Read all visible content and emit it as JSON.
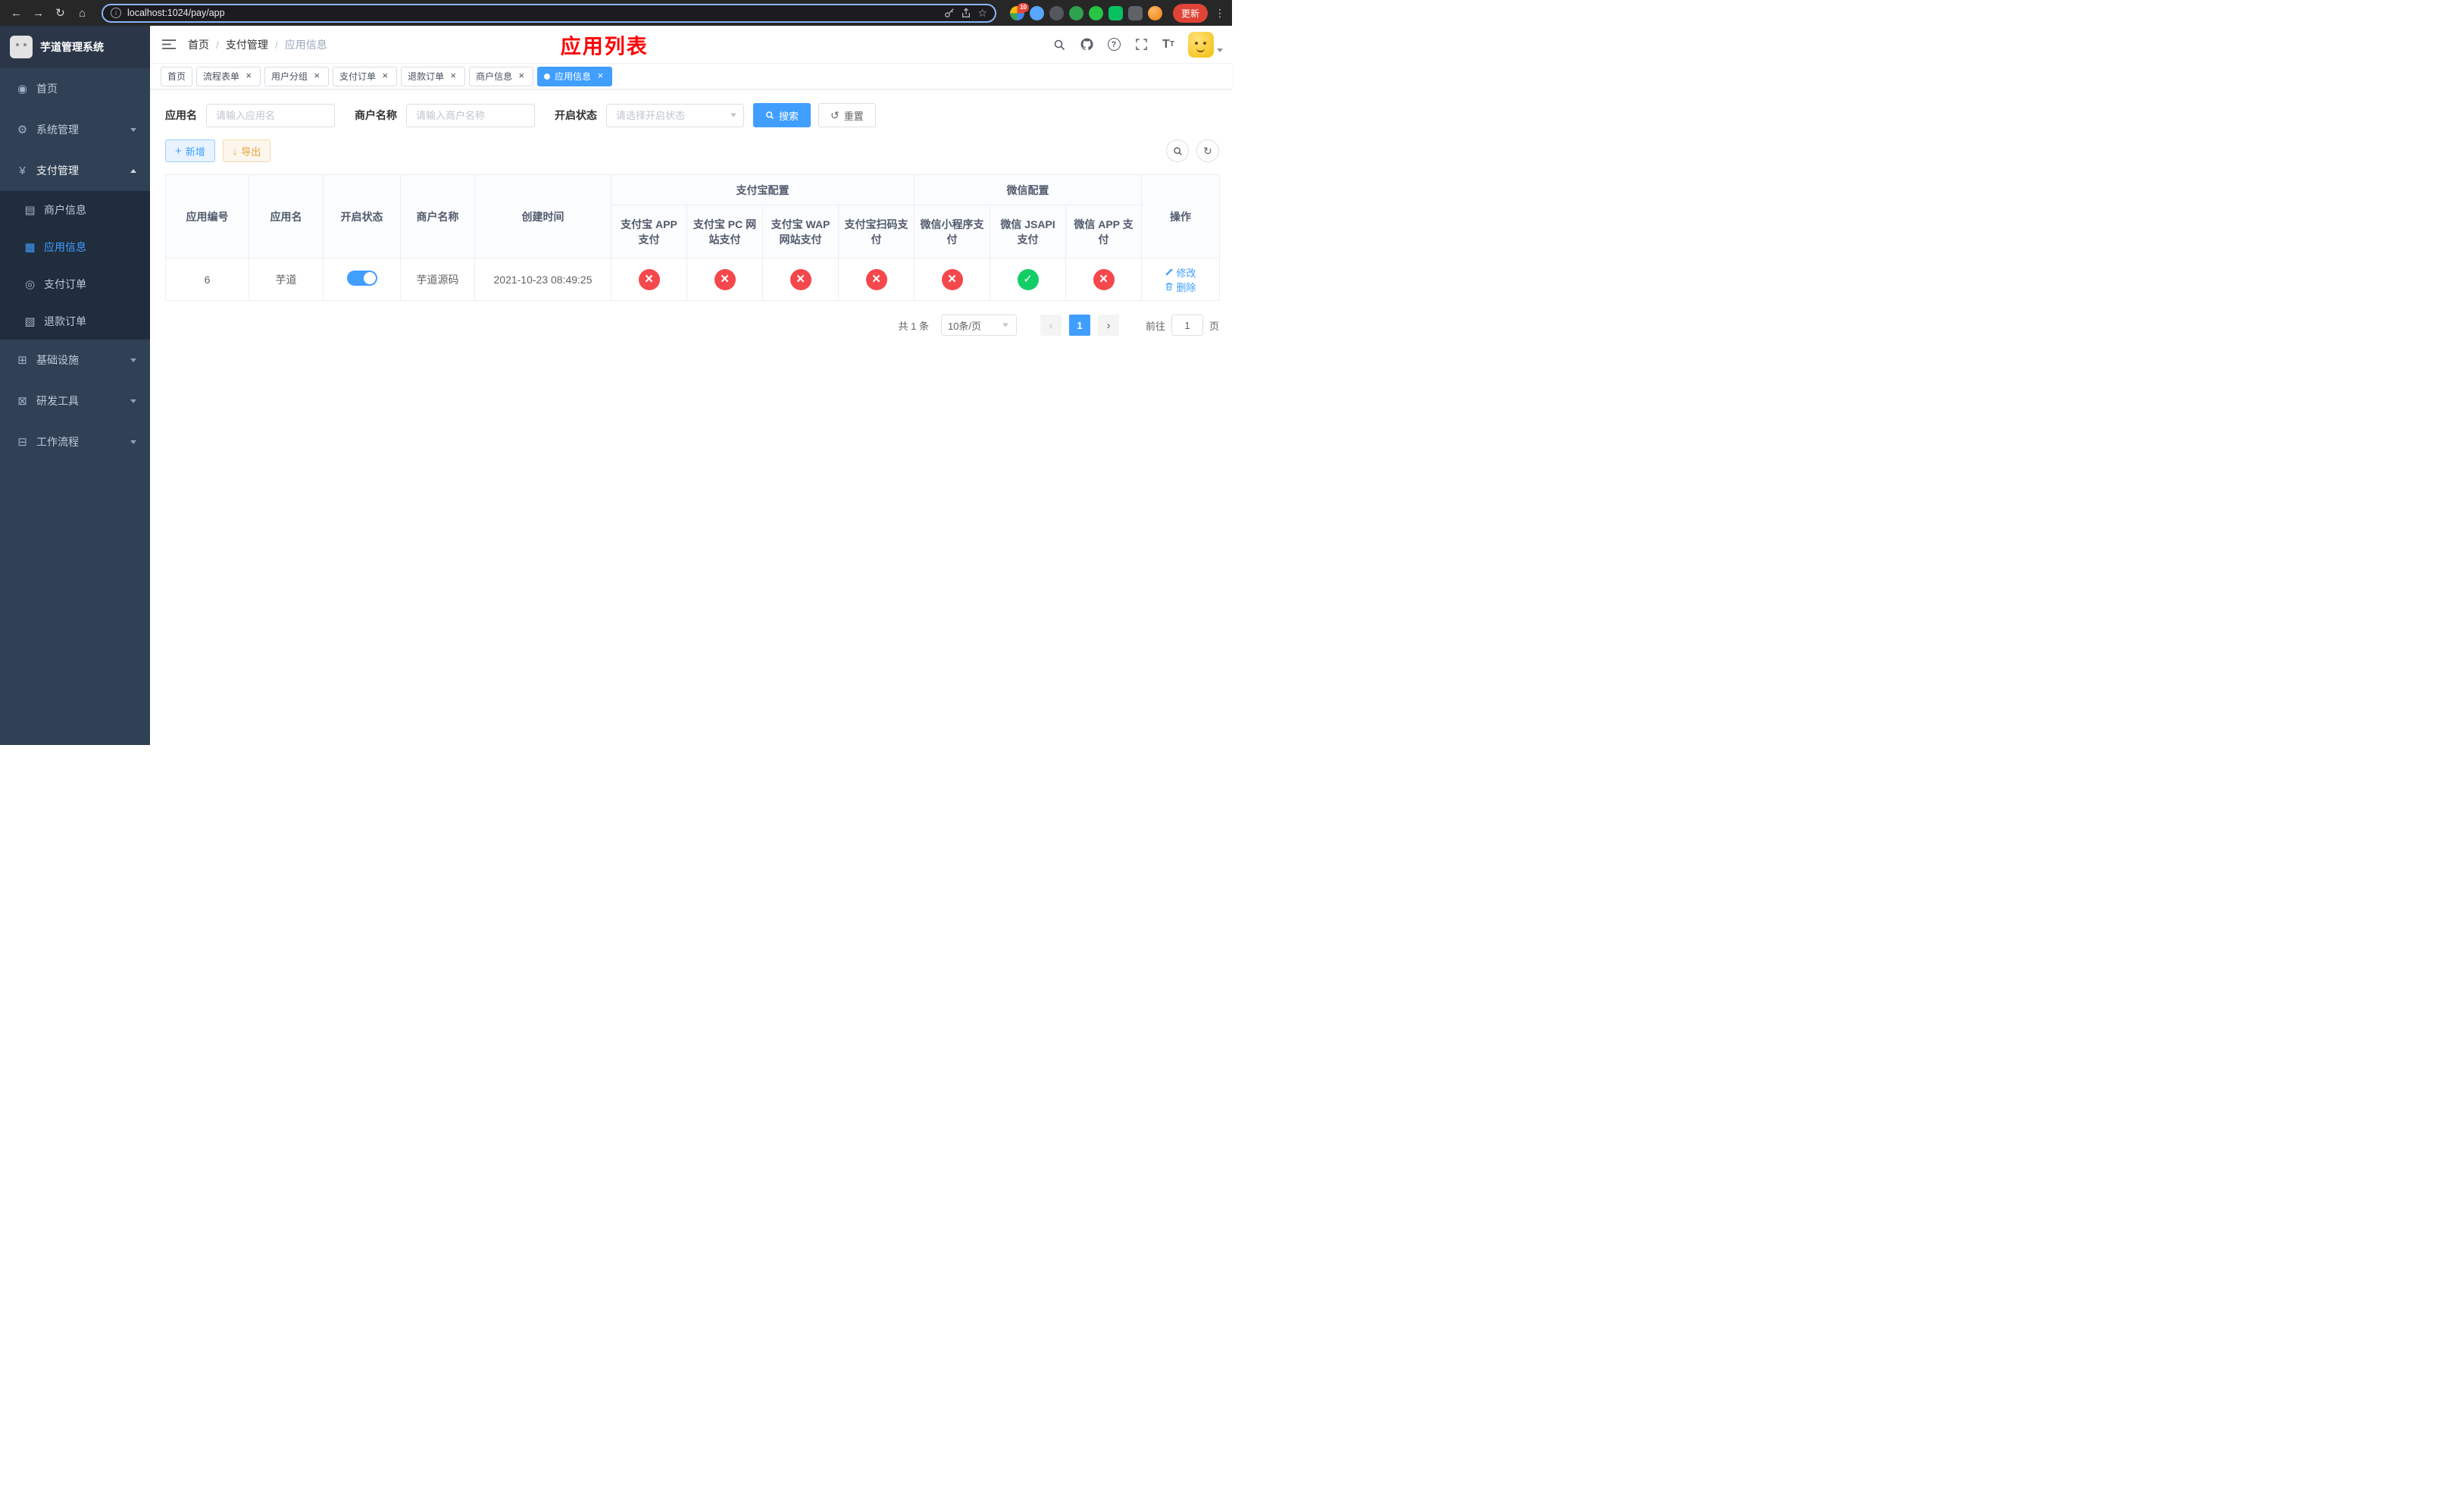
{
  "colors": {
    "primary": "#409EFF",
    "success": "#13ce66",
    "danger": "#f5484d",
    "warning": "#e6a23c",
    "page_title_red": "#ff0000",
    "sidebar_bg": "#304156",
    "submenu_bg": "#1f2d3d"
  },
  "browser": {
    "url": "localhost:1024/pay/app",
    "update_label": "更新",
    "extensions_badge": "10"
  },
  "sidebar": {
    "title": "芋道管理系统",
    "menu": [
      {
        "label": "首页",
        "icon": "dashboard-icon"
      },
      {
        "label": "系统管理",
        "icon": "gear-icon"
      },
      {
        "label": "支付管理",
        "icon": "yen-icon",
        "children": [
          {
            "label": "商户信息",
            "icon": "merchant-card-icon"
          },
          {
            "label": "应用信息",
            "icon": "app-grid-icon"
          },
          {
            "label": "支付订单",
            "icon": "pay-order-icon"
          },
          {
            "label": "退款订单",
            "icon": "refund-order-icon"
          }
        ]
      },
      {
        "label": "基础设施",
        "icon": "infrastructure-icon"
      },
      {
        "label": "研发工具",
        "icon": "devtools-icon"
      },
      {
        "label": "工作流程",
        "icon": "workflow-icon"
      }
    ]
  },
  "header": {
    "breadcrumb": [
      "首页",
      "支付管理",
      "应用信息"
    ],
    "page_title": "应用列表"
  },
  "tabs": [
    {
      "label": "首页"
    },
    {
      "label": "流程表单"
    },
    {
      "label": "用户分组"
    },
    {
      "label": "支付订单"
    },
    {
      "label": "退款订单"
    },
    {
      "label": "商户信息"
    },
    {
      "label": "应用信息"
    }
  ],
  "filters": {
    "app_name": {
      "label": "应用名",
      "placeholder": "请输入应用名",
      "value": ""
    },
    "merchant_name": {
      "label": "商户名称",
      "placeholder": "请输入商户名称",
      "value": ""
    },
    "status": {
      "label": "开启状态",
      "placeholder": "请选择开启状态",
      "value": ""
    },
    "search_label": "搜索",
    "reset_label": "重置"
  },
  "toolbar": {
    "add_label": "新增",
    "export_label": "导出"
  },
  "table": {
    "groups": [
      "支付宝配置",
      "微信配置"
    ],
    "columns": [
      "应用编号",
      "应用名",
      "开启状态",
      "商户名称",
      "创建时间",
      "支付宝 APP 支付",
      "支付宝 PC 网站支付",
      "支付宝 WAP 网站支付",
      "支付宝扫码支付",
      "微信小程序支付",
      "微信 JSAPI 支付",
      "微信 APP 支付",
      "操作"
    ],
    "rows": [
      {
        "app_id": "6",
        "app_name": "芋道",
        "status": "on",
        "merchant_name": "芋道源码",
        "create_time": "2021-10-23 08:49:25",
        "configs": [
          "off",
          "off",
          "off",
          "off",
          "off",
          "on",
          "off"
        ],
        "edit_label": "修改",
        "delete_label": "删除"
      }
    ]
  },
  "pagination": {
    "total_text": "共 1 条",
    "page_size_text": "10条/页",
    "current_page": "1",
    "goto_label": "前往",
    "goto_value": "1",
    "page_unit": "页"
  }
}
